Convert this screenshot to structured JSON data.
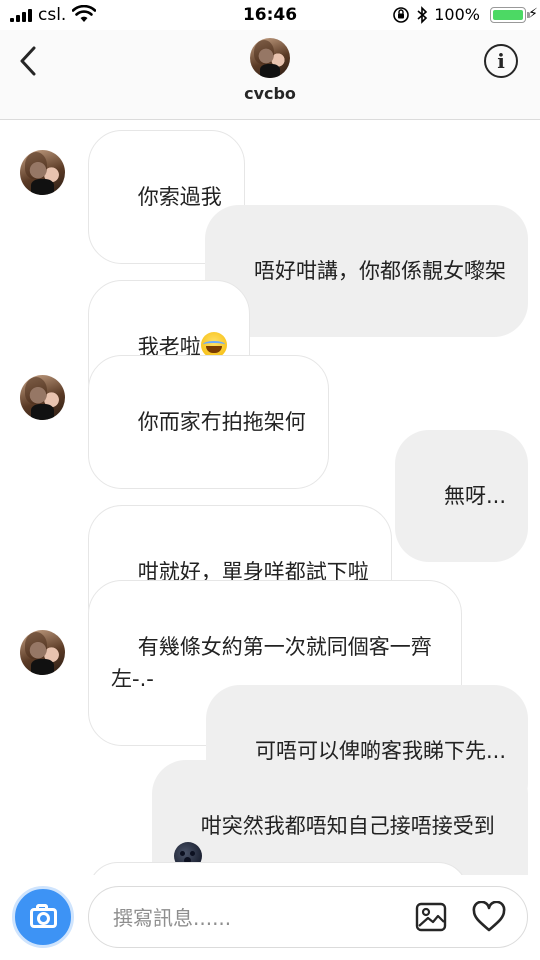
{
  "status_bar": {
    "carrier": "csl.",
    "time": "16:46",
    "battery": "100%"
  },
  "header": {
    "username": "cvcbo",
    "back_icon": "chevron-left-icon",
    "info_icon": "info-icon"
  },
  "messages": [
    {
      "direction": "in",
      "text": "你索過我",
      "avatar": true
    },
    {
      "direction": "out",
      "text": "唔好咁講，你都係靚女嚟架"
    },
    {
      "direction": "in",
      "text": "我老啦",
      "emoji": "laugh-cry-emoji"
    },
    {
      "direction": "in",
      "text": "你而家冇拍拖架何",
      "avatar": true
    },
    {
      "direction": "out",
      "text": "無呀..."
    },
    {
      "direction": "in",
      "text": "咁就好，單身咩都試下啦"
    },
    {
      "direction": "in",
      "text": "有幾條女約第一次就同個客一齊\n左-.-",
      "avatar": true
    },
    {
      "direction": "out",
      "text": "可唔可以俾啲客我睇下先..."
    },
    {
      "direction": "out",
      "text": "咁突然我都唔知自己接唔接受到",
      "emoji": "new-moon-face-emoji"
    }
  ],
  "composer": {
    "placeholder": "撰寫訊息......",
    "camera_icon": "camera-icon",
    "gallery_icon": "image-icon",
    "like_icon": "heart-icon"
  },
  "colors": {
    "outgoing_bubble": "#efefef",
    "incoming_border": "#e6e6e6",
    "camera_button": "#3d93f5",
    "battery_fill": "#4cd964"
  }
}
